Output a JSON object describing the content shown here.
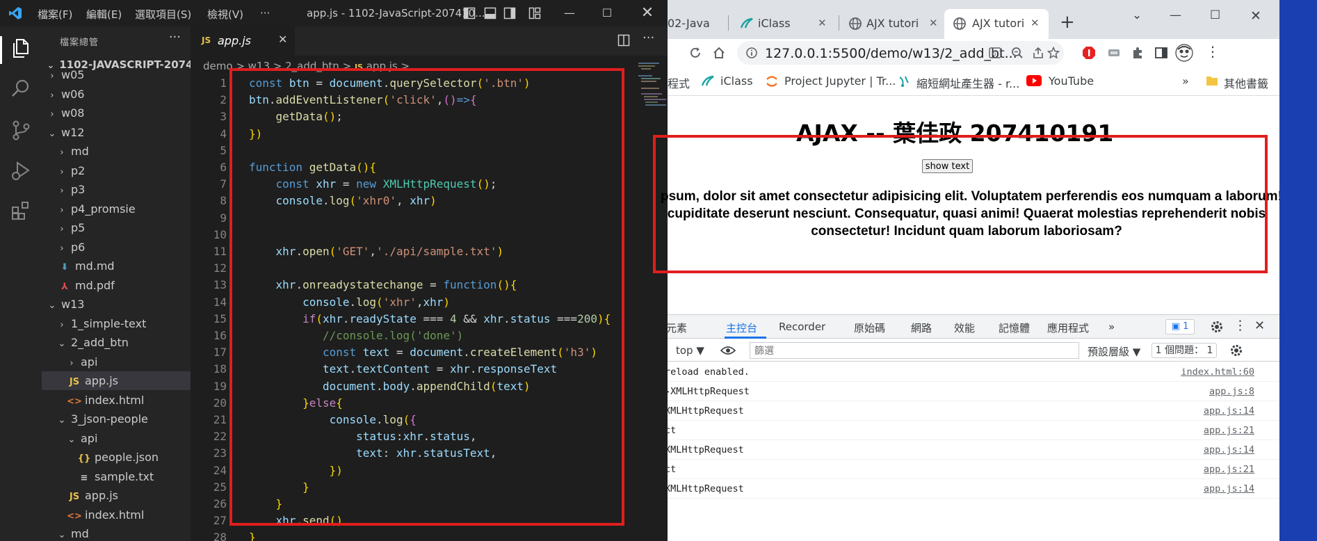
{
  "vscode": {
    "menus": [
      "檔案(F)",
      "編輯(E)",
      "選取項目(S)",
      "檢視(V)",
      "···"
    ],
    "window_title": "app.js - 1102-JavaScript-207410...",
    "explorer_title": "檔案總管",
    "explorer_more": "···",
    "project_title": "1102-JAVASCRIPT-207410...",
    "tree": [
      {
        "label": "w05",
        "type": "folder",
        "open": false,
        "depth": 1
      },
      {
        "label": "w06",
        "type": "folder",
        "open": false,
        "depth": 1
      },
      {
        "label": "w08",
        "type": "folder",
        "open": false,
        "depth": 1
      },
      {
        "label": "w12",
        "type": "folder",
        "open": true,
        "depth": 1
      },
      {
        "label": "md",
        "type": "folder",
        "open": false,
        "depth": 2
      },
      {
        "label": "p2",
        "type": "folder",
        "open": false,
        "depth": 2
      },
      {
        "label": "p3",
        "type": "folder",
        "open": false,
        "depth": 2
      },
      {
        "label": "p4_promsie",
        "type": "folder",
        "open": false,
        "depth": 2
      },
      {
        "label": "p5",
        "type": "folder",
        "open": false,
        "depth": 2
      },
      {
        "label": "p6",
        "type": "folder",
        "open": false,
        "depth": 2
      },
      {
        "label": "md.md",
        "type": "md",
        "depth": 2
      },
      {
        "label": "md.pdf",
        "type": "pdf",
        "depth": 2
      },
      {
        "label": "w13",
        "type": "folder",
        "open": true,
        "depth": 1
      },
      {
        "label": "1_simple-text",
        "type": "folder",
        "open": false,
        "depth": 2
      },
      {
        "label": "2_add_btn",
        "type": "folder",
        "open": true,
        "depth": 2
      },
      {
        "label": "api",
        "type": "folder",
        "open": false,
        "depth": 3
      },
      {
        "label": "app.js",
        "type": "js",
        "depth": 3,
        "selected": true
      },
      {
        "label": "index.html",
        "type": "html",
        "depth": 3
      },
      {
        "label": "3_json-people",
        "type": "folder",
        "open": true,
        "depth": 2
      },
      {
        "label": "api",
        "type": "folder",
        "open": true,
        "depth": 3
      },
      {
        "label": "people.json",
        "type": "json",
        "depth": 4
      },
      {
        "label": "sample.txt",
        "type": "txt",
        "depth": 4
      },
      {
        "label": "app.js",
        "type": "js",
        "depth": 3
      },
      {
        "label": "index.html",
        "type": "html",
        "depth": 3
      },
      {
        "label": "md",
        "type": "folder",
        "open": true,
        "depth": 2
      }
    ],
    "tab_label": "app.js",
    "tab_icon": "JS",
    "breadcrumb": [
      "demo",
      "w13",
      "2_add_btn",
      "app.js",
      "..."
    ],
    "code_lines": [
      "const btn = document.querySelector('.btn')",
      "btn.addEventListener('click',()=>{",
      "    getData();",
      "})",
      "",
      "function getData(){",
      "    const xhr = new XMLHttpRequest();",
      "    console.log('xhr0', xhr)",
      "",
      "",
      "    xhr.open('GET','./api/sample.txt')",
      "",
      "    xhr.onreadystatechange = function(){",
      "        console.log('xhr',xhr)",
      "        if(xhr.readyState === 4 && xhr.status ===200){",
      "           //console.log('done')",
      "           const text = document.createElement('h3')",
      "           text.textContent = xhr.responseText",
      "           document.body.appendChild(text)",
      "        }else{",
      "            console.log({",
      "                status:xhr.status,",
      "                text: xhr.statusText,",
      "            })",
      "        }",
      "    }",
      "    xhr.send()",
      "}"
    ]
  },
  "chrome": {
    "tabs": [
      "02-Java",
      "iClass",
      "AJX tutori",
      "AJX tutori"
    ],
    "url": "127.0.0.1:5500/demo/w13/2_add_bt...",
    "bookmarks": [
      "程式",
      "iClass",
      "Project Jupyter | Tr...",
      "縮短網址產生器 - r...",
      "YouTube",
      "»",
      "其他書籤"
    ],
    "page": {
      "heading": "AJAX -- 葉佳政 207410191",
      "button_label": "show text",
      "response_text": "psum, dolor sit amet consectetur adipisicing elit. Voluptatem perferendis eos numquam a laborum!\ncupiditate deserunt nesciunt. Consequatur, quasi animi! Quaerat molestias reprehenderit nobis\nconsectetur! Incidunt quam laborum laboriosam?"
    },
    "devtools": {
      "tabs": [
        "元素",
        "主控台",
        "Recorder",
        "原始碼",
        "網路",
        "效能",
        "記憶體",
        "應用程式",
        "»"
      ],
      "active_tab": "主控台",
      "badge": "1",
      "context": "top",
      "filter_placeholder": "篩選",
      "levels": "預設層級",
      "issues": "1 個問題： 1",
      "logs": [
        {
          "msg": "reload enabled.",
          "src": "index.html:60"
        },
        {
          "msg": "▸XMLHttpRequest",
          "src": "app.js:8"
        },
        {
          "msg": "XMLHttpRequest",
          "src": "app.js:14"
        },
        {
          "msg": "ct",
          "src": "app.js:21"
        },
        {
          "msg": "XMLHttpRequest",
          "src": "app.js:14"
        },
        {
          "msg": "ct",
          "src": "app.js:21"
        },
        {
          "msg": "XMLHttpRequest",
          "src": "app.js:14"
        }
      ]
    }
  },
  "colors": {
    "vscode_bg": "#1e1e1e",
    "sidebar_bg": "#252526",
    "annotation_red": "#e01e1e",
    "devtools_accent": "#1a73e8"
  }
}
